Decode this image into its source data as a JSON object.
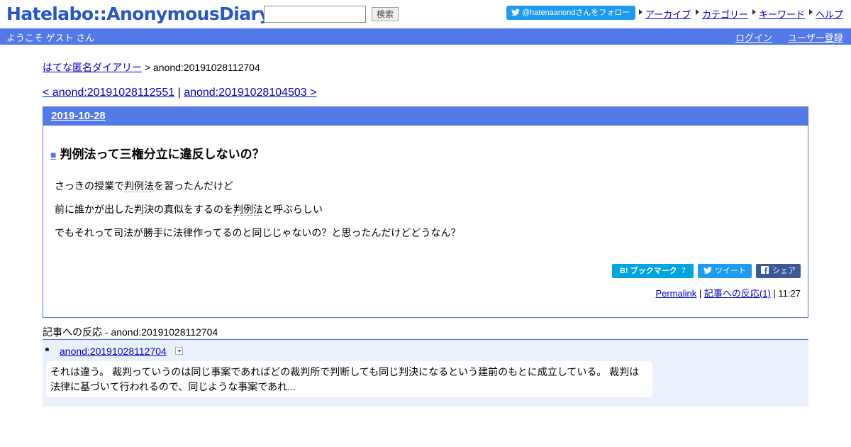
{
  "header": {
    "logo": "Hatelabo::AnonymousDiary",
    "search_button": "検索",
    "follow_button": "@hatenaanondさんをフォロー",
    "nav": [
      "アーカイブ",
      "カテゴリー",
      "キーワード",
      "ヘルプ"
    ]
  },
  "welcome_bar": {
    "greeting": "ようこそ ゲスト さん",
    "login": "ログイン",
    "register": "ユーザー登録"
  },
  "breadcrumb": {
    "home": "はてな匿名ダイアリー",
    "separator": ">",
    "current": "anond:20191028112704"
  },
  "navigation": {
    "prev": "< anond:20191028112551",
    "separator": "|",
    "next": "anond:20191028104503 >"
  },
  "entry": {
    "date": "2019-10-28",
    "title_mark": "■",
    "title": "判例法って三権分立に違反しないの？",
    "body": {
      "p1_before": "さっきの授業で",
      "p1_keyword": "判例法",
      "p1_after": "を習ったんだけど",
      "p2_before": "前に誰かが出した判決の真似をするのを",
      "p2_keyword": "判例法",
      "p2_after": "と呼ぶらしい",
      "p3": "でもそれって司法が勝手に法律作ってるのと同じじゃないの？と思ったんだけどどうなん？"
    },
    "share": {
      "bookmark": "B! ブックマーク",
      "bookmark_count": "7",
      "tweet": "ツイート",
      "facebook": "シェア"
    },
    "meta": {
      "permalink": "Permalink",
      "separator1": "|",
      "reactions": "記事への反応(1)",
      "separator2": "|",
      "time": "11:27"
    }
  },
  "reactions": {
    "heading": "記事への反応 - anond:20191028112704",
    "items": [
      {
        "link": "anond:20191028112704",
        "excerpt": "それは違う。 裁判っていうのは同じ事案であればどの裁判所で判断しても同じ判決になるという建前のもとに成立している。 裁判は法律に基づいて行われるので、同じような事案であれ..."
      }
    ]
  },
  "colors": {
    "brand_blue": "#5279e7",
    "logo_blue": "#2756c8",
    "link": "#0000cc",
    "twitter": "#1d9bf0",
    "hatena_bookmark": "#00a4de",
    "facebook": "#3b5998",
    "reaction_bg": "#ebf1fc"
  }
}
